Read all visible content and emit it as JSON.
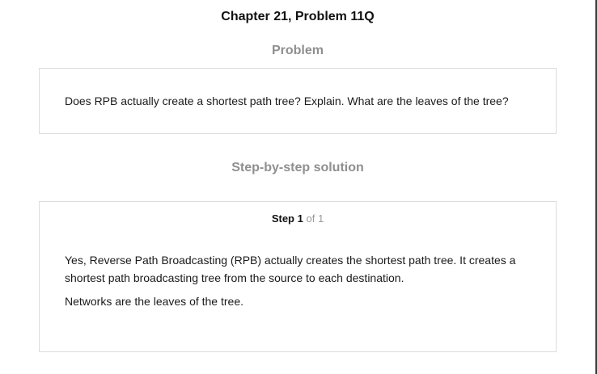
{
  "header": {
    "chapter_title": "Chapter 21, Problem 11Q"
  },
  "problem": {
    "heading": "Problem",
    "text": "Does RPB actually create a shortest path tree? Explain. What are the leaves of the tree?"
  },
  "solution": {
    "heading": "Step-by-step solution",
    "step": {
      "label": "Step",
      "number": "1",
      "of_text": "of 1"
    },
    "paragraphs": [
      "Yes, Reverse Path Broadcasting (RPB) actually creates the shortest path tree. It creates a shortest path broadcasting tree from the source to each destination.",
      "Networks are the leaves of the tree."
    ]
  }
}
